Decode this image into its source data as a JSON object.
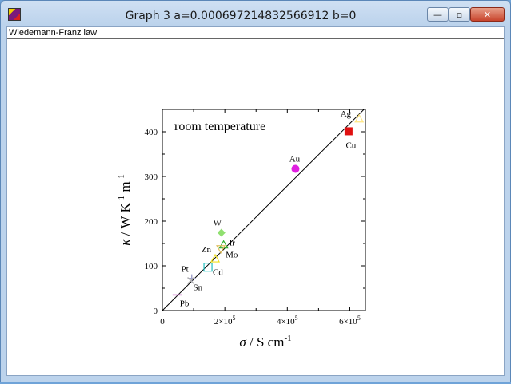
{
  "window": {
    "title": "Graph 3 a=0.000697214832566912 b=0",
    "caption": "Wiedemann-Franz law",
    "buttons": {
      "minimize": "—",
      "maximize": "▫",
      "close": "✕"
    }
  },
  "colors": {
    "Ag": "#ffe680",
    "Cu": "#e01010",
    "Au": "#e020e0",
    "W": "#90e070",
    "Ir": "#30b030",
    "Mo": "#e0c060",
    "Zn": "#f0e020",
    "Cd": "#20c0c0",
    "Pt": "#a0a0c8",
    "Sn": "#b0b0b0",
    "Pb": "#d080d0"
  },
  "chart_data": {
    "type": "scatter",
    "title": "",
    "annotation": "room temperature",
    "xlabel": {
      "symbol": "σ",
      "unit": " / S cm",
      "exp": "-1"
    },
    "ylabel": {
      "symbol": "κ",
      "unit": " / W K",
      "exp1": "-1",
      "unit2": " m",
      "exp2": "-1"
    },
    "xlim": [
      0,
      650000
    ],
    "ylim": [
      0,
      450
    ],
    "x_ticks": [
      {
        "value": 0,
        "label": "0",
        "mant": "",
        "exp": ""
      },
      {
        "value": 200000,
        "label": "",
        "mant": "2×10",
        "exp": "5"
      },
      {
        "value": 400000,
        "label": "",
        "mant": "4×10",
        "exp": "5"
      },
      {
        "value": 600000,
        "label": "",
        "mant": "6×10",
        "exp": "5"
      }
    ],
    "y_ticks": [
      0,
      100,
      200,
      300,
      400
    ],
    "fit_line": {
      "a": 0.000697214832566912,
      "b": 0
    },
    "points": [
      {
        "label": "Ag",
        "x": 630000,
        "y": 429,
        "marker": "triangle"
      },
      {
        "label": "Cu",
        "x": 596000,
        "y": 401,
        "marker": "square-filled"
      },
      {
        "label": "Au",
        "x": 426000,
        "y": 317,
        "marker": "circle-filled"
      },
      {
        "label": "W",
        "x": 189000,
        "y": 174,
        "marker": "diamond-filled"
      },
      {
        "label": "Ir",
        "x": 196000,
        "y": 147,
        "marker": "triangle"
      },
      {
        "label": "Mo",
        "x": 187000,
        "y": 138,
        "marker": "triangle-down"
      },
      {
        "label": "Zn",
        "x": 169000,
        "y": 116,
        "marker": "triangle"
      },
      {
        "label": "Cd",
        "x": 146000,
        "y": 97,
        "marker": "square"
      },
      {
        "label": "Pt",
        "x": 94000,
        "y": 72,
        "marker": "plus"
      },
      {
        "label": "Sn",
        "x": 91000,
        "y": 67,
        "marker": "cross"
      },
      {
        "label": "Pb",
        "x": 48000,
        "y": 35,
        "marker": "dash"
      }
    ]
  }
}
